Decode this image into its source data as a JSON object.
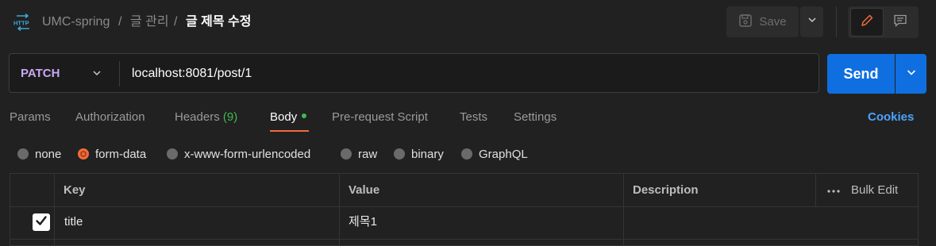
{
  "header": {
    "http_icon_label": "HTTP",
    "breadcrumb": [
      "UMC-spring",
      "글 관리",
      "글 제목 수정"
    ],
    "separator": "/",
    "save_label": "Save"
  },
  "request": {
    "method": "PATCH",
    "url": "localhost:8081/post/1",
    "send_label": "Send"
  },
  "tabs": [
    {
      "label": "Params"
    },
    {
      "label": "Authorization"
    },
    {
      "label": "Headers",
      "count": "(9)"
    },
    {
      "label": "Body",
      "active": true
    },
    {
      "label": "Pre-request Script"
    },
    {
      "label": "Tests"
    },
    {
      "label": "Settings"
    }
  ],
  "cookies_label": "Cookies",
  "body_types": [
    "none",
    "form-data",
    "x-www-form-urlencoded",
    "raw",
    "binary",
    "GraphQL"
  ],
  "selected_body_type": "form-data",
  "table": {
    "columns": [
      "Key",
      "Value",
      "Description"
    ],
    "bulk_edit": "Bulk Edit",
    "rows": [
      {
        "checked": true,
        "key": "title",
        "value": "제목1",
        "description": ""
      }
    ]
  },
  "colors": {
    "accent_orange": "#f26b3a",
    "send_blue": "#0f6fe0",
    "method_purple": "#c9a7f5",
    "count_green": "#3fb950",
    "link_blue": "#4aa3ff"
  }
}
